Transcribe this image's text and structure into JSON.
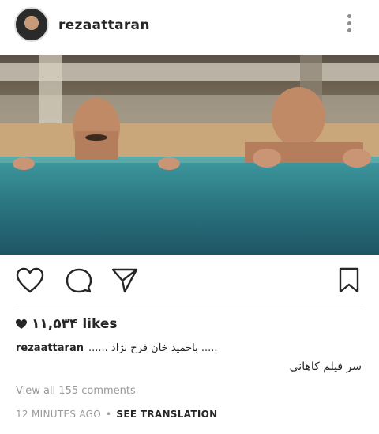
{
  "header": {
    "username": "rezaattaran",
    "avatar_icon": "avatar",
    "more_icon": "more-vertical-icon"
  },
  "post": {
    "image_description_colors": {
      "water": "#2f7f86",
      "deck": "#c9a77b"
    }
  },
  "actions": {
    "like_icon": "heart-icon",
    "comment_icon": "comment-icon",
    "share_icon": "send-icon",
    "save_icon": "bookmark-icon"
  },
  "likes": {
    "count": "۱۱,۵۳۴",
    "suffix": "likes"
  },
  "caption": {
    "username": "rezaattaran",
    "line1": "...... باحمید خان فرخ نژاد .....",
    "line2": "سر فیلم کاهانی"
  },
  "comments": {
    "view_all": "View all 155 comments"
  },
  "meta": {
    "time": "12 MINUTES AGO",
    "separator": "•",
    "translation": "SEE TRANSLATION"
  }
}
